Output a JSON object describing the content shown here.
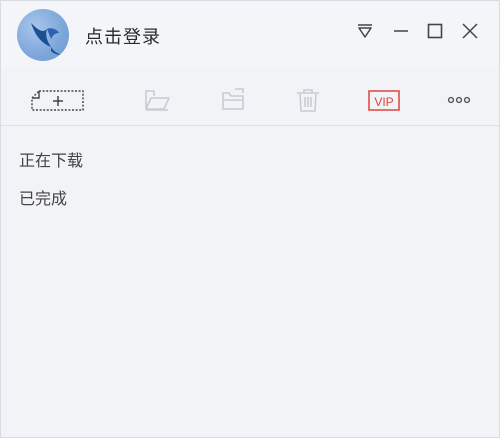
{
  "title_bar": {
    "login_label": "点击登录"
  },
  "window_controls": {
    "menu_icon": "dropdown-triangle-icon",
    "minimize_icon": "minimize-icon",
    "maximize_icon": "maximize-icon",
    "close_icon": "close-icon"
  },
  "toolbar": {
    "items": [
      {
        "name": "new-task",
        "icon": "new-task-icon"
      },
      {
        "name": "open-folder",
        "icon": "folder-icon"
      },
      {
        "name": "open-file",
        "icon": "open-file-icon"
      },
      {
        "name": "delete",
        "icon": "trash-icon"
      },
      {
        "name": "vip",
        "icon": "vip-icon",
        "label": "VIP",
        "color": "#e0433a"
      },
      {
        "name": "more",
        "icon": "more-icon"
      }
    ]
  },
  "nav": {
    "items": [
      {
        "label": "正在下载"
      },
      {
        "label": "已完成"
      }
    ]
  },
  "colors": {
    "background": "#f1f3f7",
    "icon_dark": "#444444",
    "icon_disabled": "#c8ccd3",
    "vip_red": "#e0433a"
  }
}
